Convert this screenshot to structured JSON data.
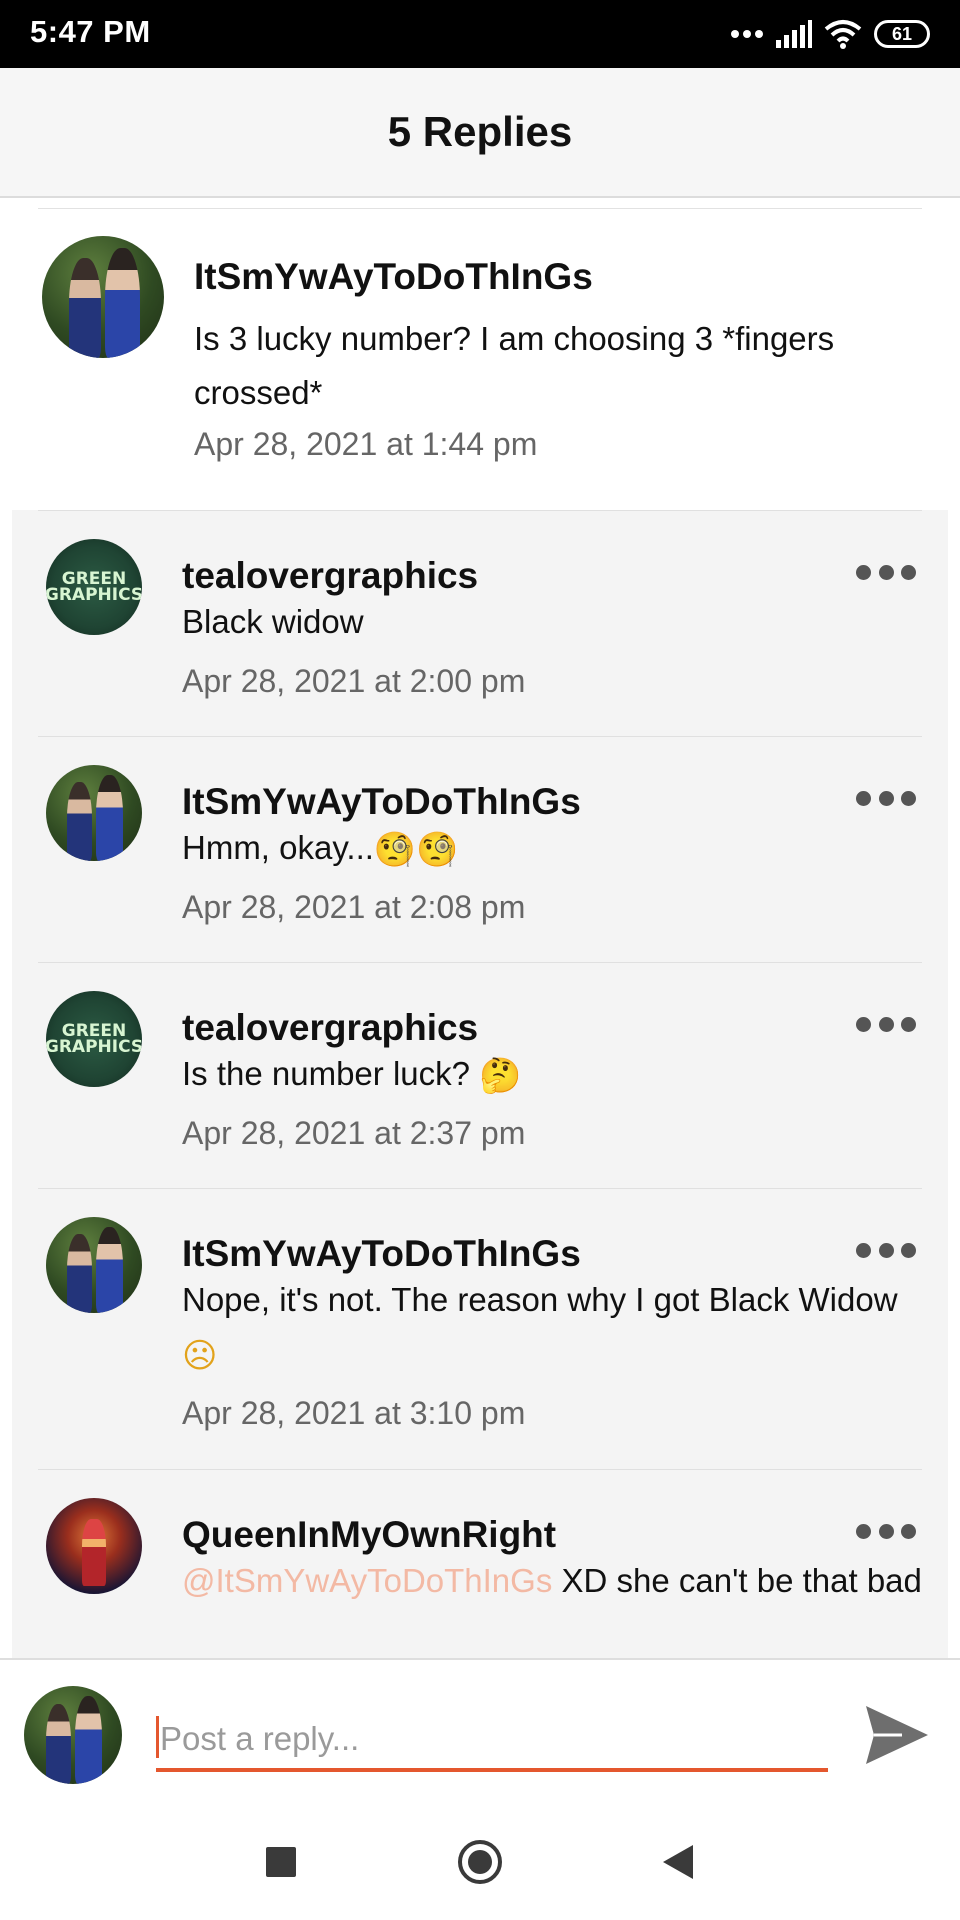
{
  "status_bar": {
    "time": "5:47 PM",
    "battery": "61"
  },
  "header": {
    "title": "5 Replies"
  },
  "main_comment": {
    "author": "ItSmYwAyToDoThInGs",
    "text": "Is 3 lucky number? I am choosing 3 *fingers crossed*",
    "time": "Apr 28, 2021 at 1:44 pm"
  },
  "replies": [
    {
      "author": "tealovergraphics",
      "avatar": "green-graphics",
      "text": "Black widow",
      "time": "Apr 28, 2021 at 2:00 pm"
    },
    {
      "author": "ItSmYwAyToDoThInGs",
      "avatar": "bts",
      "text": "Hmm, okay...",
      "emoji": "🧐🧐",
      "time": "Apr 28, 2021 at 2:08 pm"
    },
    {
      "author": "tealovergraphics",
      "avatar": "green-graphics",
      "text": "Is the number luck?",
      "emoji": "🤔",
      "time": "Apr 28, 2021 at 2:37 pm"
    },
    {
      "author": "ItSmYwAyToDoThInGs",
      "avatar": "bts",
      "text": "Nope, it's not. The reason why I got Black Widow",
      "emoji": "☹",
      "time": "Apr 28, 2021 at 3:10 pm"
    },
    {
      "author": "QueenInMyOwnRight",
      "avatar": "queen",
      "mention": "@ItSmYwAyToDoThInGs",
      "text": " XD she can't be that bad"
    }
  ],
  "avatar_text": {
    "line1": "GREEN",
    "line2": "GRAPHICS"
  },
  "composer": {
    "placeholder": "Post a reply..."
  },
  "icons": {
    "more": "more-horizontal-icon",
    "send": "send-icon",
    "nav": [
      "square-icon",
      "circle-icon",
      "back-triangle-icon"
    ]
  },
  "colors": {
    "accent": "#e4572e",
    "mention": "#f3b9a4",
    "reply_bg": "#f4f4f4"
  }
}
